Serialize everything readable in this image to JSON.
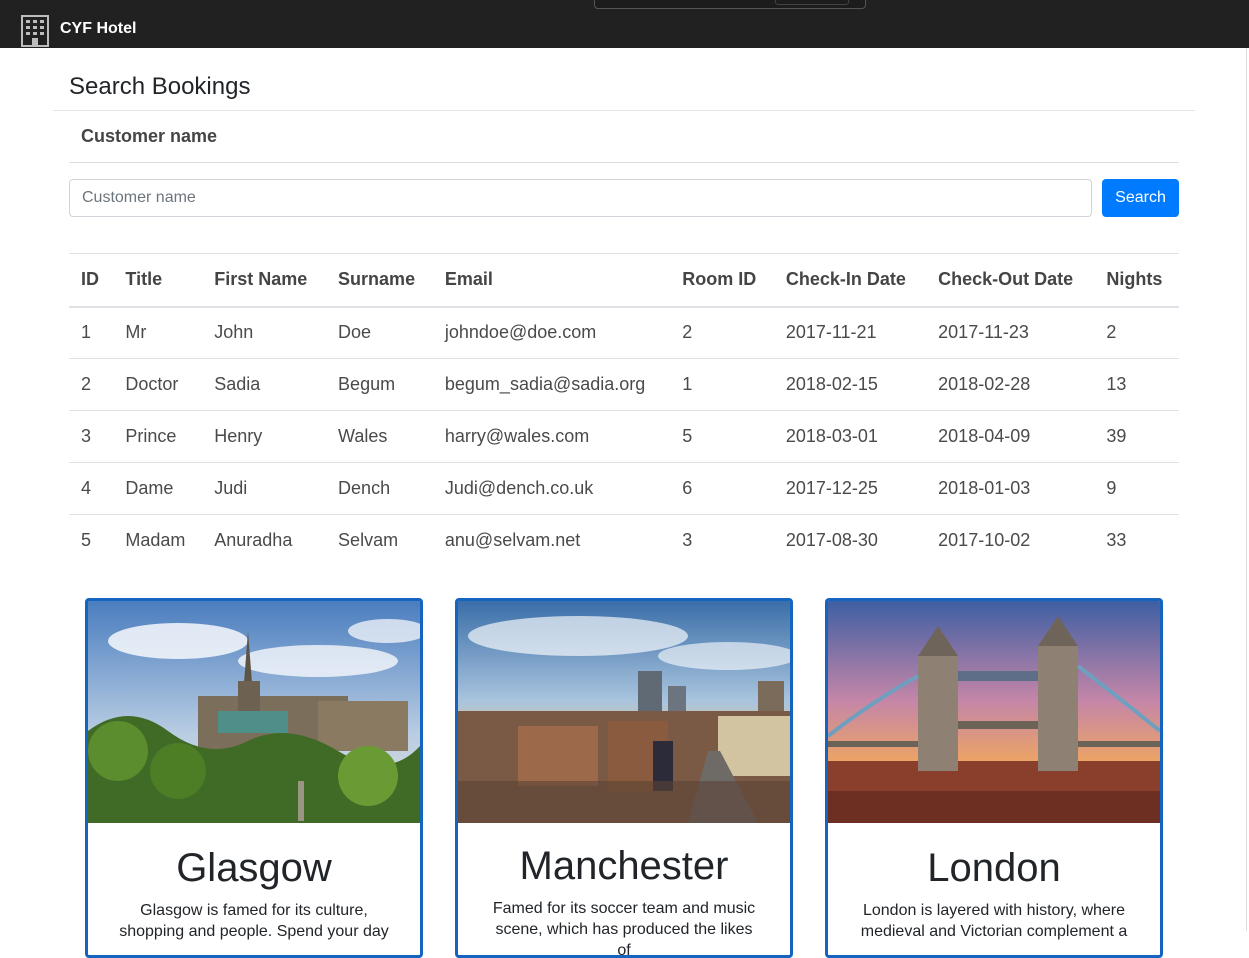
{
  "app": {
    "brand": "CYF Hotel",
    "logo_icon": "hotel-building-icon"
  },
  "search": {
    "heading": "Search Bookings",
    "label": "Customer name",
    "placeholder": "Customer name",
    "value": "",
    "button_label": "Search",
    "button_color": "#007bff"
  },
  "table": {
    "headers": [
      "ID",
      "Title",
      "First Name",
      "Surname",
      "Email",
      "Room ID",
      "Check-In Date",
      "Check-Out Date",
      "Nights"
    ],
    "rows": [
      [
        "1",
        "Mr",
        "John",
        "Doe",
        "johndoe@doe.com",
        "2",
        "2017-11-21",
        "2017-11-23",
        "2"
      ],
      [
        "2",
        "Doctor",
        "Sadia",
        "Begum",
        "begum_sadia@sadia.org",
        "1",
        "2018-02-15",
        "2018-02-28",
        "13"
      ],
      [
        "3",
        "Prince",
        "Henry",
        "Wales",
        "harry@wales.com",
        "5",
        "2018-03-01",
        "2018-04-09",
        "39"
      ],
      [
        "4",
        "Dame",
        "Judi",
        "Dench",
        "Judi@dench.co.uk",
        "6",
        "2017-12-25",
        "2018-01-03",
        "9"
      ],
      [
        "5",
        "Madam",
        "Anuradha",
        "Selvam",
        "anu@selvam.net",
        "3",
        "2017-08-30",
        "2017-10-02",
        "33"
      ]
    ]
  },
  "cities": [
    {
      "name": "Glasgow",
      "description_line1": "Glasgow is famed for its culture,",
      "description_line2": "shopping and people. Spend your day"
    },
    {
      "name": "Manchester",
      "description_line1": "Famed for its soccer team and music",
      "description_line2": "scene, which has produced the likes of"
    },
    {
      "name": "London",
      "description_line1": "London is layered with history, where",
      "description_line2": "medieval and Victorian complement a"
    }
  ],
  "colors": {
    "navbar": "#212121",
    "card_border": "#1565c0"
  }
}
